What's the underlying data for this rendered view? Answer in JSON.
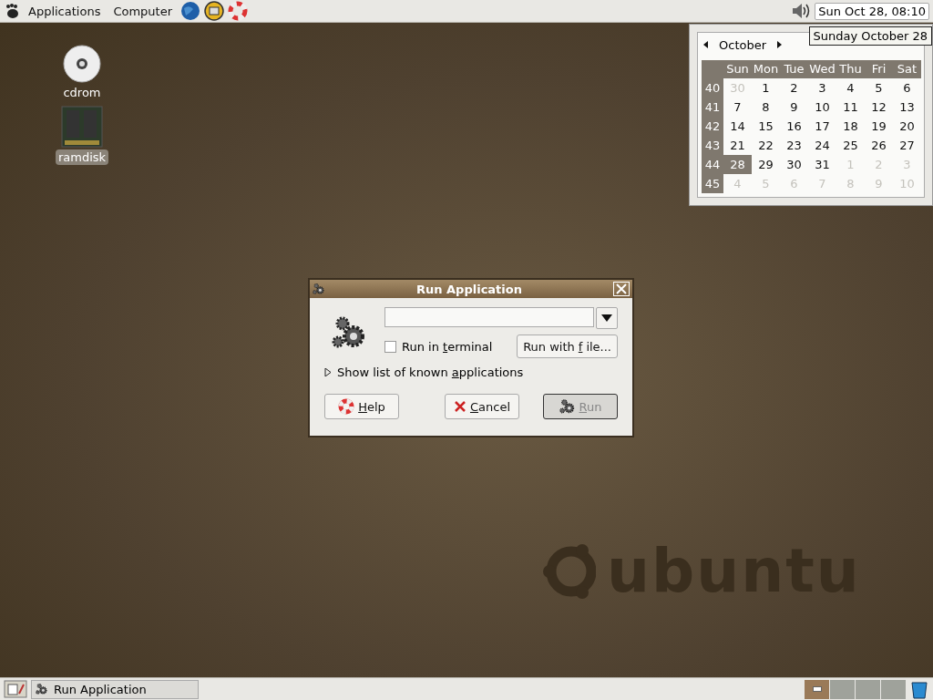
{
  "top_panel": {
    "menus": [
      {
        "label": "Applications"
      },
      {
        "label": "Computer"
      }
    ],
    "clock": "Sun Oct 28, 08:10"
  },
  "desktop_icons": [
    {
      "kind": "cdrom",
      "label": "cdrom",
      "selected": false
    },
    {
      "kind": "ramdisk",
      "label": "ramdisk",
      "selected": true
    }
  ],
  "wallpaper": {
    "logo_text": "ubuntu"
  },
  "calendar": {
    "month": "October",
    "tooltip": "Sunday October 28",
    "weekdays": [
      "Sun",
      "Mon",
      "Tue",
      "Wed",
      "Thu",
      "Fri",
      "Sat"
    ],
    "weeks": [
      {
        "number": "40",
        "days": [
          {
            "label": "30",
            "other_month": true,
            "selected": false
          },
          {
            "label": "1",
            "other_month": false,
            "selected": false
          },
          {
            "label": "2",
            "other_month": false,
            "selected": false
          },
          {
            "label": "3",
            "other_month": false,
            "selected": false
          },
          {
            "label": "4",
            "other_month": false,
            "selected": false
          },
          {
            "label": "5",
            "other_month": false,
            "selected": false
          },
          {
            "label": "6",
            "other_month": false,
            "selected": false
          }
        ]
      },
      {
        "number": "41",
        "days": [
          {
            "label": "7",
            "other_month": false,
            "selected": false
          },
          {
            "label": "8",
            "other_month": false,
            "selected": false
          },
          {
            "label": "9",
            "other_month": false,
            "selected": false
          },
          {
            "label": "10",
            "other_month": false,
            "selected": false
          },
          {
            "label": "11",
            "other_month": false,
            "selected": false
          },
          {
            "label": "12",
            "other_month": false,
            "selected": false
          },
          {
            "label": "13",
            "other_month": false,
            "selected": false
          }
        ]
      },
      {
        "number": "42",
        "days": [
          {
            "label": "14",
            "other_month": false,
            "selected": false
          },
          {
            "label": "15",
            "other_month": false,
            "selected": false
          },
          {
            "label": "16",
            "other_month": false,
            "selected": false
          },
          {
            "label": "17",
            "other_month": false,
            "selected": false
          },
          {
            "label": "18",
            "other_month": false,
            "selected": false
          },
          {
            "label": "19",
            "other_month": false,
            "selected": false
          },
          {
            "label": "20",
            "other_month": false,
            "selected": false
          }
        ]
      },
      {
        "number": "43",
        "days": [
          {
            "label": "21",
            "other_month": false,
            "selected": false
          },
          {
            "label": "22",
            "other_month": false,
            "selected": false
          },
          {
            "label": "23",
            "other_month": false,
            "selected": false
          },
          {
            "label": "24",
            "other_month": false,
            "selected": false
          },
          {
            "label": "25",
            "other_month": false,
            "selected": false
          },
          {
            "label": "26",
            "other_month": false,
            "selected": false
          },
          {
            "label": "27",
            "other_month": false,
            "selected": false
          }
        ]
      },
      {
        "number": "44",
        "days": [
          {
            "label": "28",
            "other_month": false,
            "selected": true
          },
          {
            "label": "29",
            "other_month": false,
            "selected": false
          },
          {
            "label": "30",
            "other_month": false,
            "selected": false
          },
          {
            "label": "31",
            "other_month": false,
            "selected": false
          },
          {
            "label": "1",
            "other_month": true,
            "selected": false
          },
          {
            "label": "2",
            "other_month": true,
            "selected": false
          },
          {
            "label": "3",
            "other_month": true,
            "selected": false
          }
        ]
      },
      {
        "number": "45",
        "days": [
          {
            "label": "4",
            "other_month": true,
            "selected": false
          },
          {
            "label": "5",
            "other_month": true,
            "selected": false
          },
          {
            "label": "6",
            "other_month": true,
            "selected": false
          },
          {
            "label": "7",
            "other_month": true,
            "selected": false
          },
          {
            "label": "8",
            "other_month": true,
            "selected": false
          },
          {
            "label": "9",
            "other_month": true,
            "selected": false
          },
          {
            "label": "10",
            "other_month": true,
            "selected": false
          }
        ]
      }
    ]
  },
  "dialog": {
    "title": "Run Application",
    "run_in_terminal": {
      "before": "Run in ",
      "key": "t",
      "after": "erminal",
      "checked": false
    },
    "run_with_file": {
      "before": "Run with ",
      "key": "f",
      "after": "ile..."
    },
    "known_apps": {
      "before": "Show list of known ",
      "key": "a",
      "after": "pplications",
      "expanded": false
    },
    "buttons": [
      {
        "kind": "help",
        "key": "H",
        "after": "elp",
        "disabled": false
      },
      {
        "kind": "cancel",
        "key": "C",
        "after": "ancel",
        "disabled": false
      },
      {
        "kind": "run",
        "key": "R",
        "after": "un",
        "disabled": true
      }
    ]
  },
  "bottom_panel": {
    "tasks": [
      {
        "label": "Run Application",
        "selected": false
      }
    ],
    "workspaces": [
      {
        "selected": true
      },
      {
        "selected": false
      },
      {
        "selected": false
      },
      {
        "selected": false
      }
    ]
  }
}
